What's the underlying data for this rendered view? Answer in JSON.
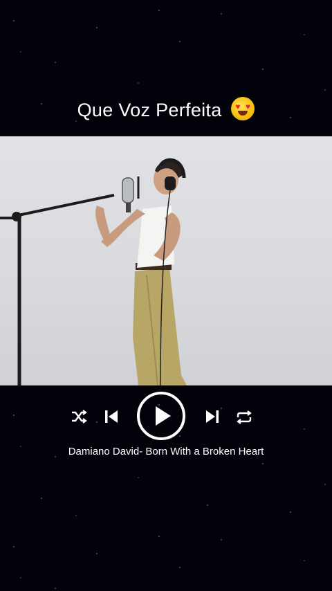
{
  "caption": {
    "text": "Que Voz Perfeita",
    "emoji": "heart-eyes-emoji"
  },
  "player": {
    "song_title": "Damiano David- Born With a Broken Heart",
    "controls": {
      "shuffle": "shuffle-icon",
      "previous": "skip-previous-icon",
      "play": "play-icon",
      "next": "skip-next-icon",
      "repeat": "repeat-icon"
    }
  },
  "colors": {
    "background": "#02030a",
    "text": "#ffffff",
    "video_wall": "#dcdee1"
  }
}
